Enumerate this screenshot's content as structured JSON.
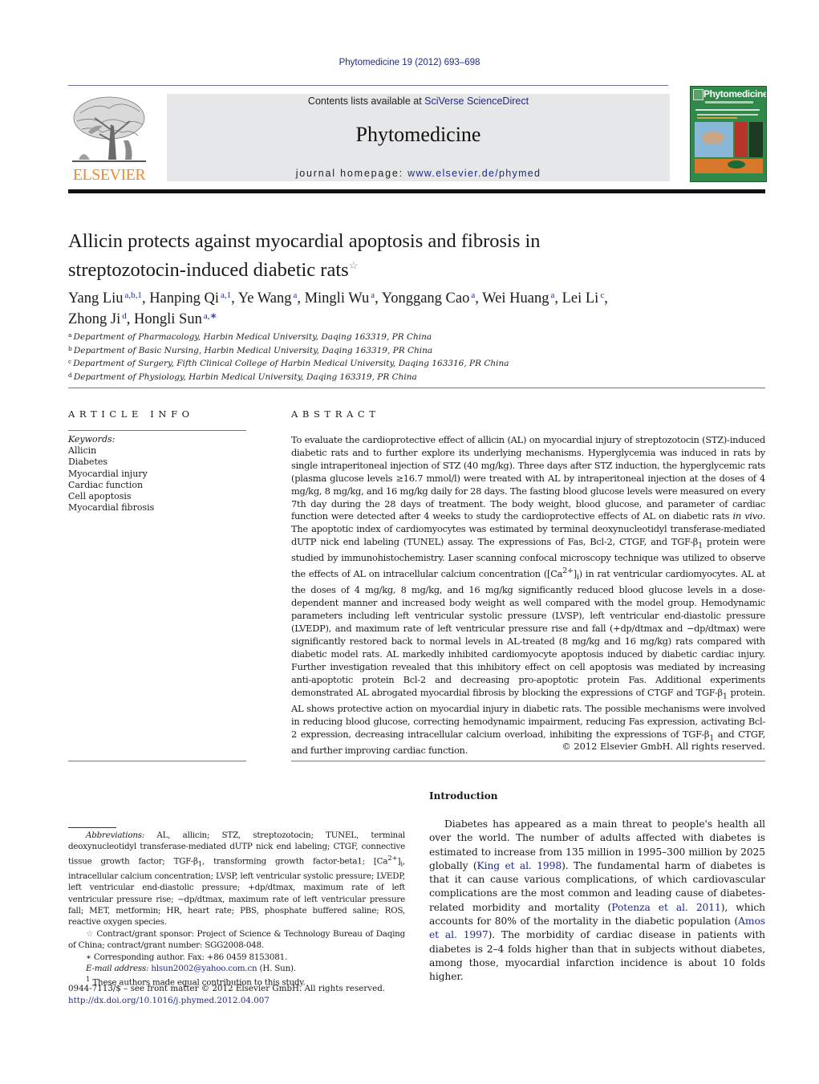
{
  "header": {
    "citation": "Phytomedicine 19 (2012) 693–698",
    "publisher_logo_text": "ELSEVIER",
    "contents_prefix": "Contents lists available at ",
    "contents_link": "SciVerse ScienceDirect",
    "journal_title": "Phytomedicine",
    "homepage_prefix": "journal homepage: ",
    "homepage_link": "www.elsevier.de/phymed",
    "cover_title": "Phytomedicine"
  },
  "article": {
    "title_line1": "Allicin protects against myocardial apoptosis and fibrosis in",
    "title_line2": "streptozotocin-induced diabetic rats",
    "title_note_mark": "☆",
    "authors": [
      {
        "name": "Yang Liu",
        "sup": "a,b,1",
        "sep": ", "
      },
      {
        "name": "Hanping Qi",
        "sup": "a,1",
        "sep": ", "
      },
      {
        "name": "Ye Wang",
        "sup": "a",
        "sep": ", "
      },
      {
        "name": "Mingli Wu",
        "sup": "a",
        "sep": ", "
      },
      {
        "name": "Yonggang Cao",
        "sup": "a",
        "sep": ", "
      },
      {
        "name": "Wei Huang",
        "sup": "a",
        "sep": ", "
      },
      {
        "name": "Lei Li",
        "sup": "c",
        "sep": ","
      },
      {
        "name": "Zhong Ji",
        "sup": "d",
        "sep": ", "
      },
      {
        "name": "Hongli Sun",
        "sup": "a,∗",
        "sep": ""
      }
    ],
    "affiliations": [
      {
        "mark": "a",
        "text": "Department of Pharmacology, Harbin Medical University, Daqing 163319, PR China"
      },
      {
        "mark": "b",
        "text": "Department of Basic Nursing, Harbin Medical University, Daqing 163319, PR China"
      },
      {
        "mark": "c",
        "text": "Department of Surgery, Fifth Clinical College of Harbin Medical University, Daqing 163316, PR China"
      },
      {
        "mark": "d",
        "text": "Department of Physiology, Harbin Medical University, Daqing 163319, PR China"
      }
    ]
  },
  "article_info": {
    "heading": "ARTICLE INFO",
    "keywords_label": "Keywords:",
    "keywords": [
      "Allicin",
      "Diabetes",
      "Myocardial injury",
      "Cardiac function",
      "Cell apoptosis",
      "Myocardial fibrosis"
    ]
  },
  "abstract": {
    "heading": "ABSTRACT",
    "p1": "To evaluate the cardioprotective effect of allicin (AL) on myocardial injury of streptozotocin (STZ)-induced diabetic rats and to further explore its underlying mechanisms. Hyperglycemia was induced in rats by single intraperitoneal injection of STZ (40 mg/kg). Three days after STZ induction, the hyperglycemic rats (plasma glucose levels ≥16.7 mmol/l) were treated with AL by intraperitoneal injection at the doses of 4 mg/kg, 8 mg/kg, and 16 mg/kg daily for 28 days. The fasting blood glucose levels were measured on every 7th day during the 28 days of treatment. The body weight, blood glucose, and parameter of cardiac function were detected after 4 weeks to study the cardioprotective effects of AL on diabetic rats ",
    "p1_italic": "in vivo",
    "p2": ". The apoptotic index of cardiomyocytes was estimated by terminal deoxynucleotidyl transferase-mediated dUTP nick end labeling (TUNEL) assay. The expressions of Fas, Bcl-2, CTGF, and TGF-β",
    "p2_sub": "1",
    "p3": " protein were studied by immunohistochemistry. Laser scanning confocal microscopy technique was utilized to observe the effects of AL on intracellular calcium concentration ([Ca",
    "p3_sup": "2+",
    "p3b": "]",
    "p3_sub": "i",
    "p4": ") in rat ventricular cardiomyocytes. AL at the doses of 4 mg/kg, 8 mg/kg, and 16 mg/kg significantly reduced blood glucose levels in a dose-dependent manner and increased body weight as well compared with the model group. Hemodynamic parameters including left ventricular systolic pressure (LVSP), left ventricular end-diastolic pressure (LVEDP), and maximum rate of left ventricular pressure rise and fall (+dp/dtmax and −dp/dtmax) were significantly restored back to normal levels in AL-treated (8 mg/kg and 16 mg/kg) rats compared with diabetic model rats. AL markedly inhibited cardiomyocyte apoptosis induced by diabetic cardiac injury. Further investigation revealed that this inhibitory effect on cell apoptosis was mediated by increasing anti-apoptotic protein Bcl-2 and decreasing pro-apoptotic protein Fas. Additional experiments demonstrated AL abrogated myocardial fibrosis by blocking the expressions of CTGF and TGF-β",
    "p4_sub": "1",
    "p5": " protein. AL shows protective action on myocardial injury in diabetic rats. The possible mechanisms were involved in reducing blood glucose, correcting hemodynamic impairment, reducing Fas expression, activating Bcl-2 expression, decreasing intracellular calcium overload, inhibiting the expressions of TGF-β",
    "p5_sub": "1",
    "p6": " and CTGF, and further improving cardiac function.",
    "copyright": "© 2012 Elsevier GmbH. All rights reserved."
  },
  "footnotes": {
    "abbrev_label": "Abbreviations:",
    "abbrev_a": " AL, allicin; STZ, streptozotocin; TUNEL, terminal deoxynucleotidyl transferase-mediated dUTP nick end labeling; CTGF, connective tissue growth factor; TGF-β",
    "abbrev_sub1": "1",
    "abbrev_b": ", transforming growth factor-beta1; [Ca",
    "abbrev_sup": "2+",
    "abbrev_c": "]",
    "abbrev_sub2": "i",
    "abbrev_d": ", intracellular calcium concentration; LVSP, left ventricular systolic pressure; LVEDP, left ventricular end-diastolic pressure; +dp/dtmax, maximum rate of left ventricular pressure rise; −dp/dtmax, maximum rate of left ventricular pressure fall; MET, metformin; HR, heart rate; PBS, phosphate buffered saline; ROS, reactive oxygen species.",
    "grant_mark": "☆",
    "grant_text": " Contract/grant sponsor: Project of Science & Technology Bureau of Daqing of China; contract/grant number: SGG2008-048.",
    "corr_mark": "∗",
    "corr_text": " Corresponding author. Fax: +86 0459 8153081.",
    "email_label": "E-mail address:",
    "email": "hlsun2002@yahoo.com.cn",
    "email_suffix": " (H. Sun).",
    "equal_mark": "1",
    "equal_text": " These authors made equal contribution to this study.",
    "issn_line": "0944-7113/$ – see front matter © 2012 Elsevier GmbH. All rights reserved.",
    "doi": "http://dx.doi.org/10.1016/j.phymed.2012.04.007"
  },
  "introduction": {
    "heading": "Introduction",
    "t1": "Diabetes has appeared as a main threat to people's health all over the world. The number of adults affected with diabetes is estimated to increase from 135 million in 1995–300 million by 2025 globally (",
    "ref1": "King et al. 1998",
    "t2": "). The fundamental harm of diabetes is that it can cause various complications, of which cardiovascular complications are the most common and leading cause of diabetes-related morbidity and mortality (",
    "ref2": "Potenza et al. 2011",
    "t3": "), which accounts for 80% of the mortality in the diabetic population (",
    "ref3": "Amos et al. 1997",
    "t4": "). The morbidity of cardiac disease in patients with diabetes is 2–4 folds higher than that in subjects without diabetes, among those, myocardial infarction incidence is about 10 folds higher."
  }
}
